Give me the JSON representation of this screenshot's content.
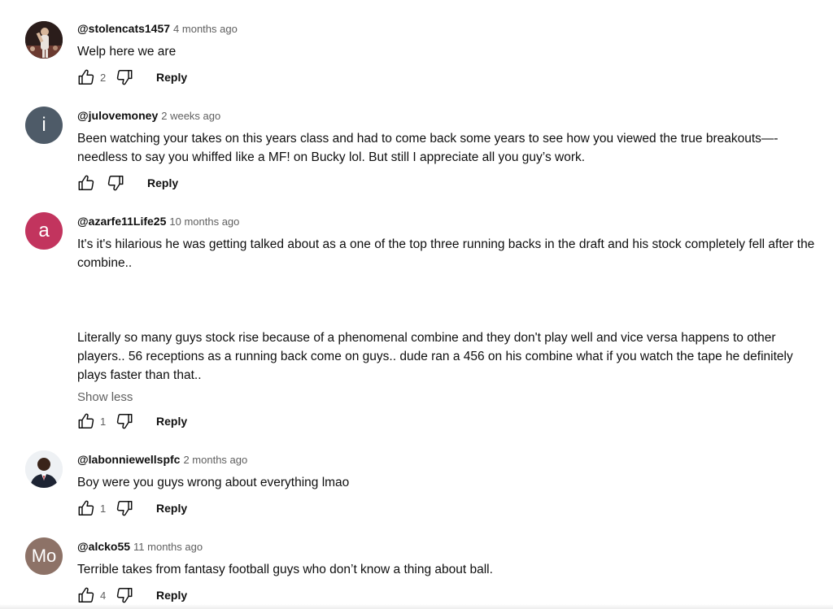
{
  "comments": [
    {
      "handle": "@stolencats1457",
      "time": "4 months ago",
      "text": "Welp here we are",
      "likes": "2",
      "reply": "Reply",
      "avatar": {
        "type": "photo",
        "icon": "profile-photo"
      }
    },
    {
      "handle": "@julovemoney",
      "time": "2 weeks ago",
      "text": "Been watching your takes on this years class and had to come back some years to see how you viewed the true breakouts—-needless to say you whiffed like a MF! on Bucky lol. But still I appreciate all you guy’s  work.",
      "likes": "",
      "reply": "Reply",
      "avatar": {
        "type": "letter",
        "letter": "i",
        "color": "#4e5b68"
      }
    },
    {
      "handle": "@azarfe11Life25",
      "time": "10 months ago",
      "text": "It's it's hilarious he was getting talked about as a one of the top three running backs in the draft and his stock completely fell after the combine..",
      "text2": "Literally so many guys stock rise because of a phenomenal combine and they don't play well and vice versa happens to other players..   56 receptions as a running back come on guys..  dude ran a 456 on his combine what if you watch the tape he definitely plays faster than that..",
      "show_less": "Show less",
      "likes": "1",
      "reply": "Reply",
      "avatar": {
        "type": "letter",
        "letter": "a",
        "color": "#c2345e"
      }
    },
    {
      "handle": "@labonniewellspfc",
      "time": "2 months ago",
      "text": "Boy were you guys wrong about everything lmao",
      "likes": "1",
      "reply": "Reply",
      "avatar": {
        "type": "photo",
        "icon": "profile-photo"
      }
    },
    {
      "handle": "@alcko55",
      "time": "11 months ago",
      "text": "Terrible takes from fantasy football guys who don’t know a thing about ball.",
      "likes": "4",
      "reply": "Reply",
      "avatar": {
        "type": "letter",
        "letter": "Mo",
        "color": "#8d7267"
      }
    }
  ],
  "icons": {
    "like": "thumbs-up-icon",
    "dislike": "thumbs-down-icon"
  }
}
